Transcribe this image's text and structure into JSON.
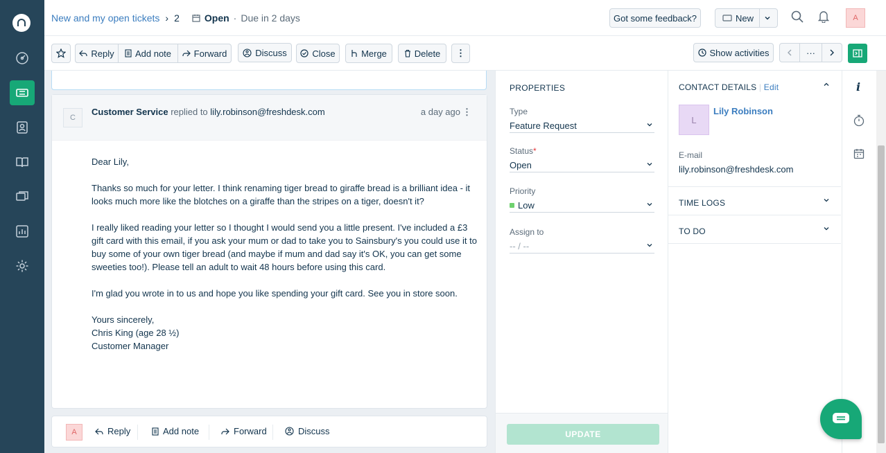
{
  "nav": {
    "items": [
      "dashboard",
      "tickets",
      "contacts",
      "solutions",
      "forums",
      "reports",
      "admin"
    ]
  },
  "header": {
    "breadcrumb_link": "New and my open tickets",
    "ticket_count": "2",
    "status": "Open",
    "due": "Due in 2 days",
    "feedback_label": "Got some feedback?",
    "new_label": "New",
    "user_initial": "A"
  },
  "toolbar": {
    "reply": "Reply",
    "add_note": "Add note",
    "forward": "Forward",
    "discuss": "Discuss",
    "close": "Close",
    "merge": "Merge",
    "delete": "Delete",
    "show_activities": "Show activities",
    "more": "···"
  },
  "message": {
    "avatar_initial": "C",
    "sender": "Customer Service",
    "action": "replied to",
    "recipient": "lily.robinson@freshdesk.com",
    "time": "a day ago",
    "body": [
      "Dear Lily,",
      "Thanks so much for your letter. I think renaming tiger bread to giraffe bread is a brilliant idea - it looks much more like the blotches on a giraffe than the stripes on a tiger, doesn't it?",
      "I really liked reading your letter so I thought I would send you a little present. I've included a £3 gift card with this email, if you ask your mum or dad to take you to Sainsbury's you could use it to buy some of your own tiger bread (and maybe if mum and dad say it's OK, you can get some sweeties too!). Please tell an adult to wait 48 hours before using this card.",
      "I'm glad you wrote in to us and hope you like spending your gift card. See you in store soon."
    ],
    "signoff": [
      "Yours sincerely,",
      "Chris King (age 28 ½)",
      "Customer Manager"
    ]
  },
  "replybar": {
    "user_initial": "A",
    "reply": "Reply",
    "add_note": "Add note",
    "forward": "Forward",
    "discuss": "Discuss"
  },
  "properties": {
    "title": "PROPERTIES",
    "type_label": "Type",
    "type_value": "Feature Request",
    "status_label": "Status",
    "status_required": "*",
    "status_value": "Open",
    "priority_label": "Priority",
    "priority_value": "Low",
    "priority_color": "#6fd16f",
    "assign_label": "Assign to",
    "assign_value": "-- / --",
    "update_label": "UPDATE"
  },
  "contact": {
    "title": "CONTACT DETAILS",
    "edit": "Edit",
    "avatar_initial": "L",
    "name": "Lily Robinson",
    "email_label": "E-mail",
    "email": "lily.robinson@freshdesk.com",
    "time_logs": "TIME LOGS",
    "todo": "TO DO"
  },
  "colors": {
    "accent": "#17a877",
    "nav_bg": "#264559",
    "link": "#3b7dbf"
  }
}
